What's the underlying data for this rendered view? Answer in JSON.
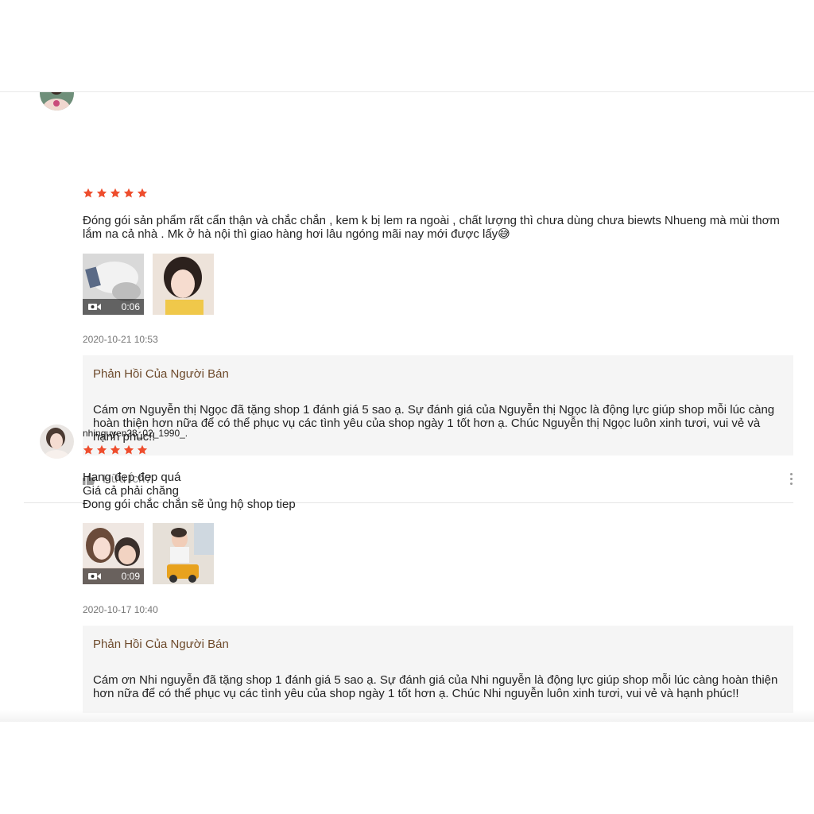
{
  "colors": {
    "star": "#ee4d2d",
    "reply_title": "#6d4a2b",
    "reply_bg": "#f5f5f5"
  },
  "reviews": [
    {
      "username": "",
      "rating": 5,
      "comment": "Đóng gói sản phẩm rất cẩn thận và chắc chắn , kem k bị lem ra ngoài , chất lượng thì chưa dùng chưa biewts Nhueng mà mùi thơm lắm na cả nhà . Mk ở hà nội thì giao hàng hơi lâu ngóng mãi nay mới được lấy😅",
      "video_duration": "0:06",
      "date": "2020-10-21 10:53",
      "reply_title": "Phản Hồi Của Người Bán",
      "reply_text": "Cám ơn Nguyễn thị Ngọc đã tặng shop 1 đánh giá 5 sao ạ. Sự đánh giá của Nguyễn thị Ngọc là động lực giúp shop mỗi lúc càng hoàn thiện hơn nữa để có thể phục vụ các tình yêu của shop ngày 1 tốt hơn ạ. Chúc Nguyễn thị Ngọc luôn xinh tươi, vui vẻ và hạnh phúc!!",
      "helpful_label": "Hữu Ích?"
    },
    {
      "username": "nhinguyen28_02_1990_.",
      "rating": 5,
      "comment": "Hang đẹp đẹp quá\nGiá cả phải chăng\nĐong gói chắc chắn sẽ ủng hộ shop tiep",
      "video_duration": "0:09",
      "date": "2020-10-17 10:40",
      "reply_title": "Phản Hồi Của Người Bán",
      "reply_text": "Cám ơn Nhi nguyễn đã tặng shop 1 đánh giá 5 sao ạ. Sự đánh giá của Nhi nguyễn là động lực giúp shop mỗi lúc càng hoàn thiện hơn nữa để có thể phục vụ các tình yêu của shop ngày 1 tốt hơn ạ. Chúc Nhi nguyễn luôn xinh tươi, vui vẻ và hạnh phúc!!"
    }
  ]
}
